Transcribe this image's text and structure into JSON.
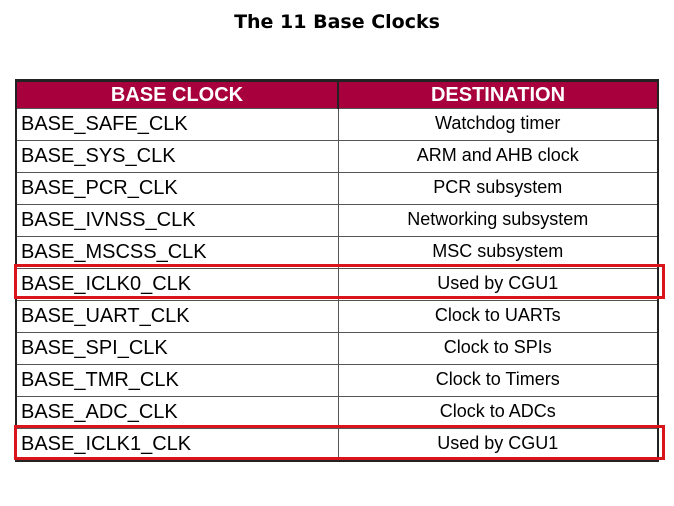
{
  "title": "The 11 Base Clocks",
  "table": {
    "headers": [
      "BASE CLOCK",
      "DESTINATION"
    ],
    "header_color": "#a8003c",
    "rows": [
      {
        "clock": "BASE_SAFE_CLK",
        "destination": "Watchdog timer",
        "highlighted": false
      },
      {
        "clock": "BASE_SYS_CLK",
        "destination": "ARM and AHB clock",
        "highlighted": false
      },
      {
        "clock": "BASE_PCR_CLK",
        "destination": "PCR subsystem",
        "highlighted": false
      },
      {
        "clock": "BASE_IVNSS_CLK",
        "destination": "Networking subsystem",
        "highlighted": false
      },
      {
        "clock": "BASE_MSCSS_CLK",
        "destination": "MSC subsystem",
        "highlighted": false
      },
      {
        "clock": "BASE_ICLK0_CLK",
        "destination": "Used by CGU1",
        "highlighted": true
      },
      {
        "clock": "BASE_UART_CLK",
        "destination": "Clock to UARTs",
        "highlighted": false
      },
      {
        "clock": "BASE_SPI_CLK",
        "destination": "Clock to SPIs",
        "highlighted": false
      },
      {
        "clock": "BASE_TMR_CLK",
        "destination": "Clock to Timers",
        "highlighted": false
      },
      {
        "clock": "BASE_ADC_CLK",
        "destination": "Clock to ADCs",
        "highlighted": false
      },
      {
        "clock": "BASE_ICLK1_CLK",
        "destination": "Used by CGU1",
        "highlighted": true
      }
    ],
    "highlight_color": "#d9141a"
  }
}
